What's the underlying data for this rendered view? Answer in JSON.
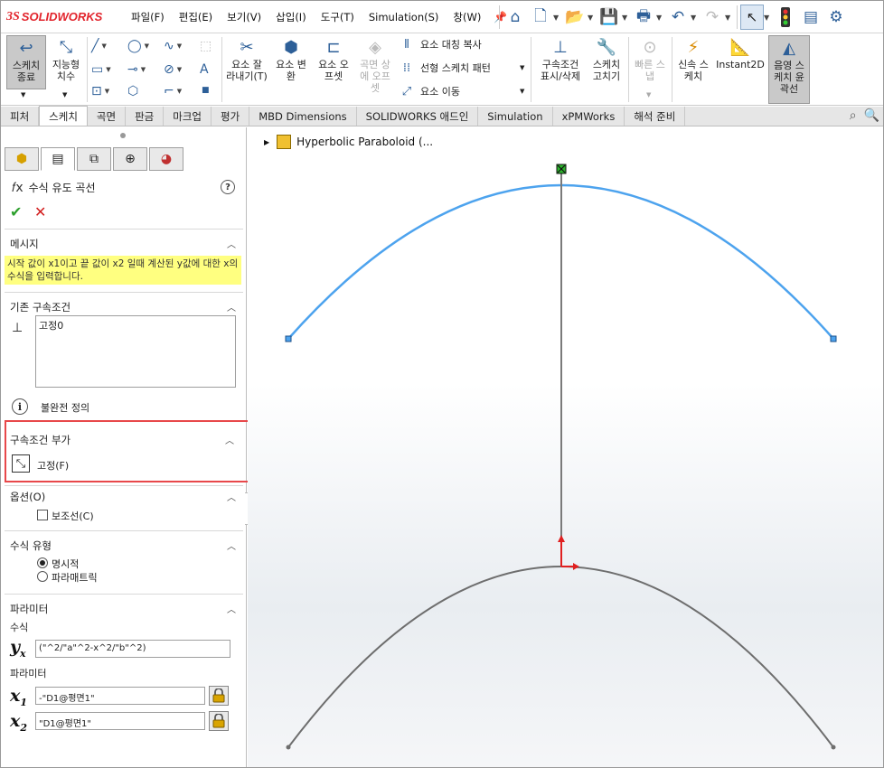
{
  "app": {
    "brand_ds": "3S",
    "brand_name": "SOLIDWORKS"
  },
  "menu": [
    "파일(F)",
    "편집(E)",
    "보기(V)",
    "삽입(I)",
    "도구(T)",
    "Simulation(S)",
    "창(W)"
  ],
  "ribbon": {
    "exit_sketch": "스케치\n종료",
    "smart_dim": "지능형\n치수",
    "trim": "요소 잘\n라내기(T)",
    "convert": "요소 변\n환",
    "offset": "요소 오\n프셋",
    "surface_offset": "곡면 상\n에 오프\n셋",
    "mirror": "요소 대칭 복사",
    "linear_pattern": "선형 스케치 패턴",
    "move": "요소 이동",
    "display_relations": "구속조건\n표시/삭제",
    "repair": "스케치\n고치기",
    "quick_snap": "빠른 스\n냅",
    "rapid_sketch": "신속 스\n케치",
    "instant2d": "Instant2D",
    "shaded_sketch": "음영 스\n케치 윤\n곽선"
  },
  "tabs": [
    "피처",
    "스케치",
    "곡면",
    "판금",
    "마크업",
    "평가",
    "MBD Dimensions",
    "SOLIDWORKS 애드인",
    "Simulation",
    "xPMWorks",
    "해석 준비"
  ],
  "active_tab": "스케치",
  "panel": {
    "title": "수식 유도 곡선",
    "message_header": "메시지",
    "message_text": "시작 값이 x1이고 끝 값이 x2 일때 계산된 y값에 대한 x의 수식을 입력합니다.",
    "existing_header": "기존 구속조건",
    "existing_items": [
      "고정0"
    ],
    "definition_status": "불완전 정의",
    "add_header": "구속조건 부가",
    "add_fix_label": "고정(F)",
    "options_header": "옵션(O)",
    "construction_label": "보조선(C)",
    "eq_type_header": "수식 유형",
    "explicit_label": "명시적",
    "parametric_label": "파라매트릭",
    "params_header": "파라미터",
    "equation_label": "수식",
    "equation_value": "(\"^2/\"a\"^2-x^2/\"b\"^2)",
    "parameter_label": "파라미터",
    "x1_value": "-\"D1@평면1\"",
    "x2_value": "\"D1@평면1\"",
    "var_y": "y",
    "var_y_sub": "x",
    "var_x": "x",
    "var_x1_sub": "1",
    "var_x2_sub": "2"
  },
  "tree": {
    "root": "Hyperbolic Paraboloid (..."
  },
  "colors": {
    "selected_curve": "#4da3ee",
    "curve": "#6e6e6e",
    "highlight": "#e8484a",
    "message_bg": "#ffff80"
  }
}
